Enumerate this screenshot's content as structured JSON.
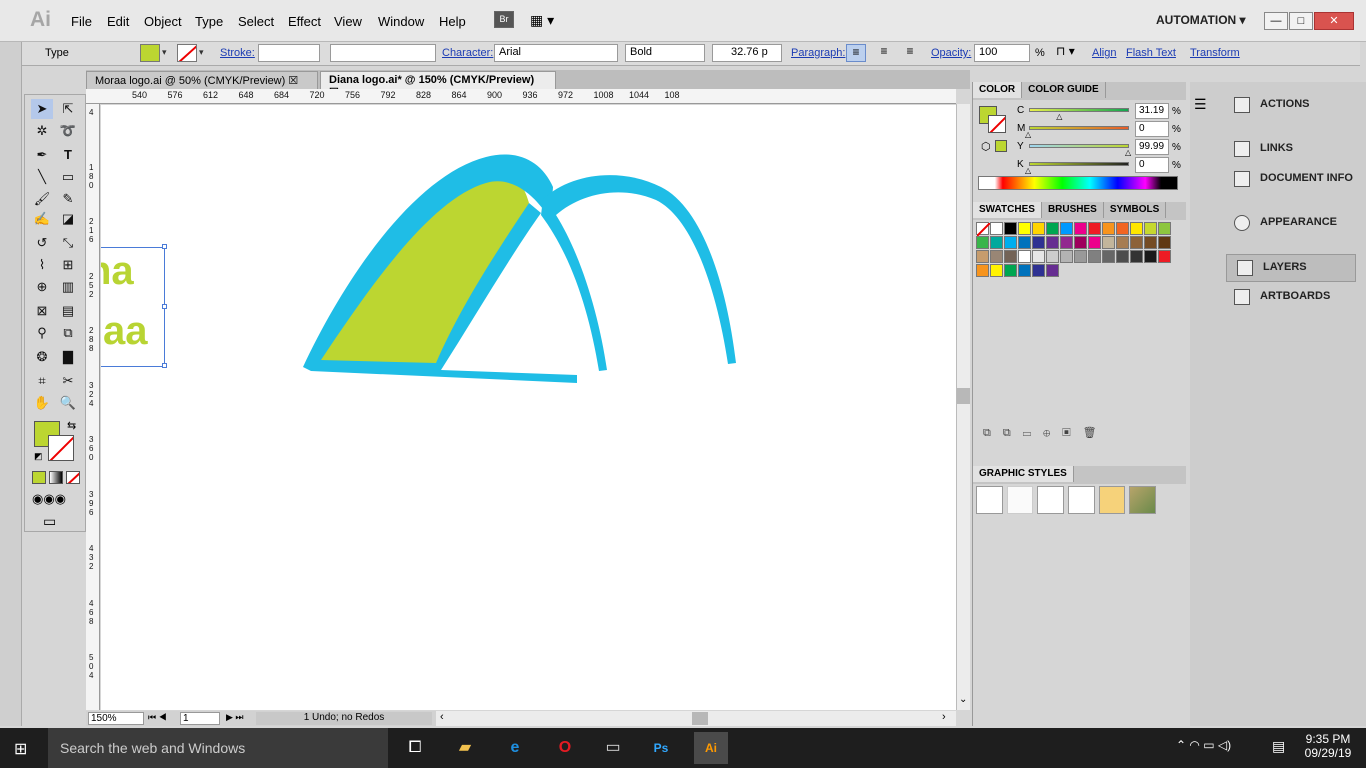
{
  "app": {
    "logo": "Ai",
    "workspace": "AUTOMATION",
    "bridge": "Br"
  },
  "menu": [
    "File",
    "Edit",
    "Object",
    "Type",
    "Select",
    "Effect",
    "View",
    "Window",
    "Help"
  ],
  "control": {
    "mode": "Type",
    "stroke_label": "Stroke:",
    "character_label": "Character:",
    "font": "Arial",
    "style": "Bold",
    "size": "32.76 p",
    "paragraph_label": "Paragraph:",
    "opacity_label": "Opacity:",
    "opacity": "100",
    "percent": "%",
    "align_label": "Align",
    "flash_text_label": "Flash Text",
    "transform_label": "Transform"
  },
  "tabs": [
    {
      "label": "Moraa logo.ai @ 50% (CMYK/Preview)"
    },
    {
      "label": "Diana logo.ai* @ 150% (CMYK/Preview)"
    }
  ],
  "ruler_top": [
    "540",
    "576",
    "612",
    "648",
    "684",
    "720",
    "756",
    "792",
    "828",
    "864",
    "900",
    "936",
    "972",
    "1008",
    "1044",
    "108"
  ],
  "ruler_left": [
    "4",
    "1\n8\n0",
    "2\n1\n6",
    "2\n5\n2",
    "2\n8\n8",
    "3\n2\n4",
    "3\n6\n0",
    "3\n9\n6",
    "4\n3\n2",
    "4\n6\n8",
    "5\n0\n4"
  ],
  "artwork": {
    "text_line1": "na",
    "text_line2": "aa",
    "fill_color": "#bcd631",
    "stroke_color": "#1fbde6",
    "text_color": "#b8d433"
  },
  "status": {
    "zoom": "150%",
    "artboard": "1",
    "undo_text": "1 Undo; no Redos"
  },
  "color_panel": {
    "tabs": [
      "COLOR",
      "COLOR GUIDE"
    ],
    "channels": [
      {
        "label": "C",
        "value": "31.19",
        "fraction": 0.3119
      },
      {
        "label": "M",
        "value": "0",
        "fraction": 0
      },
      {
        "label": "Y",
        "value": "99.99",
        "fraction": 0.9999
      },
      {
        "label": "K",
        "value": "0",
        "fraction": 0
      }
    ],
    "unit": "%",
    "fill": "#bcd631"
  },
  "swatches_panel": {
    "tabs": [
      "SWATCHES",
      "BRUSHES",
      "SYMBOLS"
    ],
    "colors": [
      "#ffffff",
      "#000000",
      "#ffff00",
      "#ffd400",
      "#00a651",
      "#0099ff",
      "#ed008c",
      "#ee1c24",
      "#f7941d",
      "#f26522",
      "#ffe600",
      "#c6d82f",
      "#8dc63f",
      "#39b54a",
      "#00a99d",
      "#00aeef",
      "#0072bc",
      "#2e3192",
      "#662d91",
      "#92278f",
      "#9e005d",
      "#ec008c",
      "#c2b59b",
      "#a67c52",
      "#8c6239",
      "#754c24",
      "#603913",
      "#c69c6d",
      "#998675",
      "#736357",
      "#ffffff",
      "#e6e6e6",
      "#cccccc",
      "#b3b3b3",
      "#999999",
      "#808080",
      "#666666",
      "#4d4d4d",
      "#333333",
      "#1a1a1a",
      "#ed1c24",
      "#f7941d",
      "#fff200",
      "#00a651",
      "#0072bc",
      "#2e3192",
      "#662d91"
    ]
  },
  "graphic_styles": {
    "title": "GRAPHIC STYLES"
  },
  "dock": [
    "ACTIONS",
    "LINKS",
    "DOCUMENT INFO",
    "APPEARANCE",
    "LAYERS",
    "ARTBOARDS"
  ],
  "taskbar": {
    "search": "Search the web and Windows",
    "time": "9:35 PM",
    "date": "09/29/19"
  }
}
